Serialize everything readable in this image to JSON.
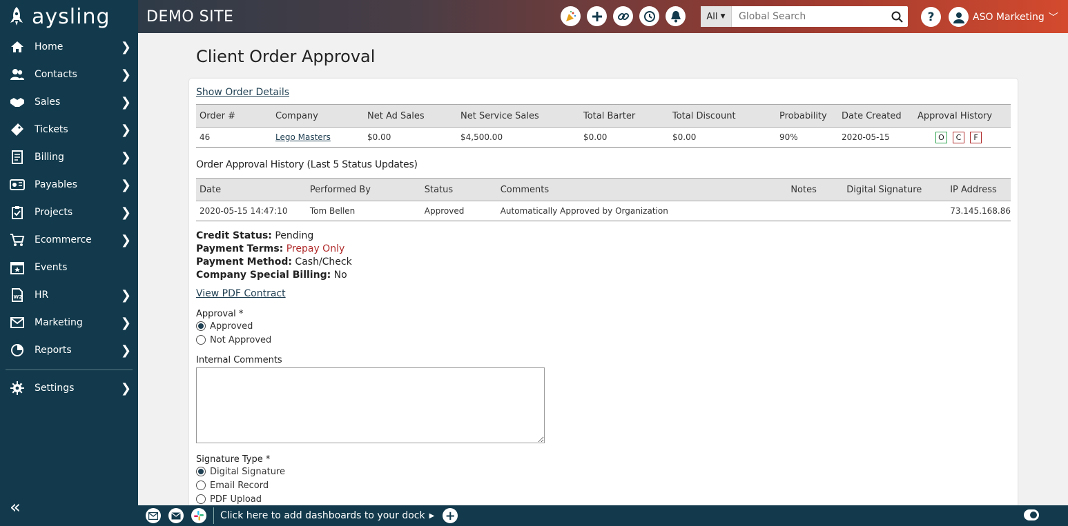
{
  "brand": {
    "name": "aysling"
  },
  "topbar": {
    "site_name": "DEMO SITE",
    "search": {
      "scope": "All",
      "placeholder": "Global Search"
    },
    "user_name": "ASO Marketing"
  },
  "sidebar": {
    "items": [
      {
        "label": "Home",
        "icon": "home-icon"
      },
      {
        "label": "Contacts",
        "icon": "contacts-icon"
      },
      {
        "label": "Sales",
        "icon": "handshake-icon"
      },
      {
        "label": "Tickets",
        "icon": "ticket-icon"
      },
      {
        "label": "Billing",
        "icon": "billing-icon"
      },
      {
        "label": "Payables",
        "icon": "payables-icon"
      },
      {
        "label": "Projects",
        "icon": "clipboard-icon"
      },
      {
        "label": "Ecommerce",
        "icon": "cart-icon"
      },
      {
        "label": "Events",
        "icon": "calendar-icon"
      },
      {
        "label": "HR",
        "icon": "w2-icon"
      },
      {
        "label": "Marketing",
        "icon": "envelope-icon"
      },
      {
        "label": "Reports",
        "icon": "reports-icon"
      }
    ],
    "settings_label": "Settings"
  },
  "page": {
    "title": "Client Order Approval",
    "show_details_link": "Show Order Details",
    "order_table": {
      "headers": [
        "Order #",
        "Company",
        "Net Ad Sales",
        "Net Service Sales",
        "Total Barter",
        "Total Discount",
        "Probability",
        "Date Created",
        "Approval History"
      ],
      "row": {
        "order": "46",
        "company": "Lego Masters",
        "net_ad_sales": "$0.00",
        "net_service_sales": "$4,500.00",
        "total_barter": "$0.00",
        "total_discount": "$0.00",
        "probability": "90%",
        "date_created": "2020-05-15",
        "badges": [
          "O",
          "C",
          "F"
        ]
      }
    },
    "history_title": "Order Approval History (Last 5 Status Updates)",
    "history_table": {
      "headers": [
        "Date",
        "Performed By",
        "Status",
        "Comments",
        "Notes",
        "Digital Signature",
        "IP Address"
      ],
      "row": {
        "date": "2020-05-15 14:47:10",
        "performed_by": "Tom Bellen",
        "status": "Approved",
        "comments": "Automatically Approved by Organization",
        "notes": "",
        "digital_signature": "",
        "ip": "73.145.168.86"
      }
    },
    "info": {
      "credit_status_label": "Credit Status:",
      "credit_status": "Pending",
      "payment_terms_label": "Payment Terms:",
      "payment_terms": "Prepay Only",
      "payment_method_label": "Payment Method:",
      "payment_method": "Cash/Check",
      "special_billing_label": "Company Special Billing:",
      "special_billing": "No"
    },
    "pdf_link": "View PDF Contract",
    "approval": {
      "label": "Approval *",
      "options": [
        "Approved",
        "Not Approved"
      ],
      "selected": "Approved"
    },
    "comments_label": "Internal Comments",
    "signature": {
      "label": "Signature Type *",
      "options": [
        "Digital Signature",
        "Email Record",
        "PDF Upload"
      ],
      "selected": "Digital Signature"
    }
  },
  "dock": {
    "text": "Click here to add dashboards to your dock"
  },
  "colors": {
    "sidebar": "#123a4c",
    "accent_red": "#b02a2a",
    "topbar_end": "#d44a2e"
  }
}
